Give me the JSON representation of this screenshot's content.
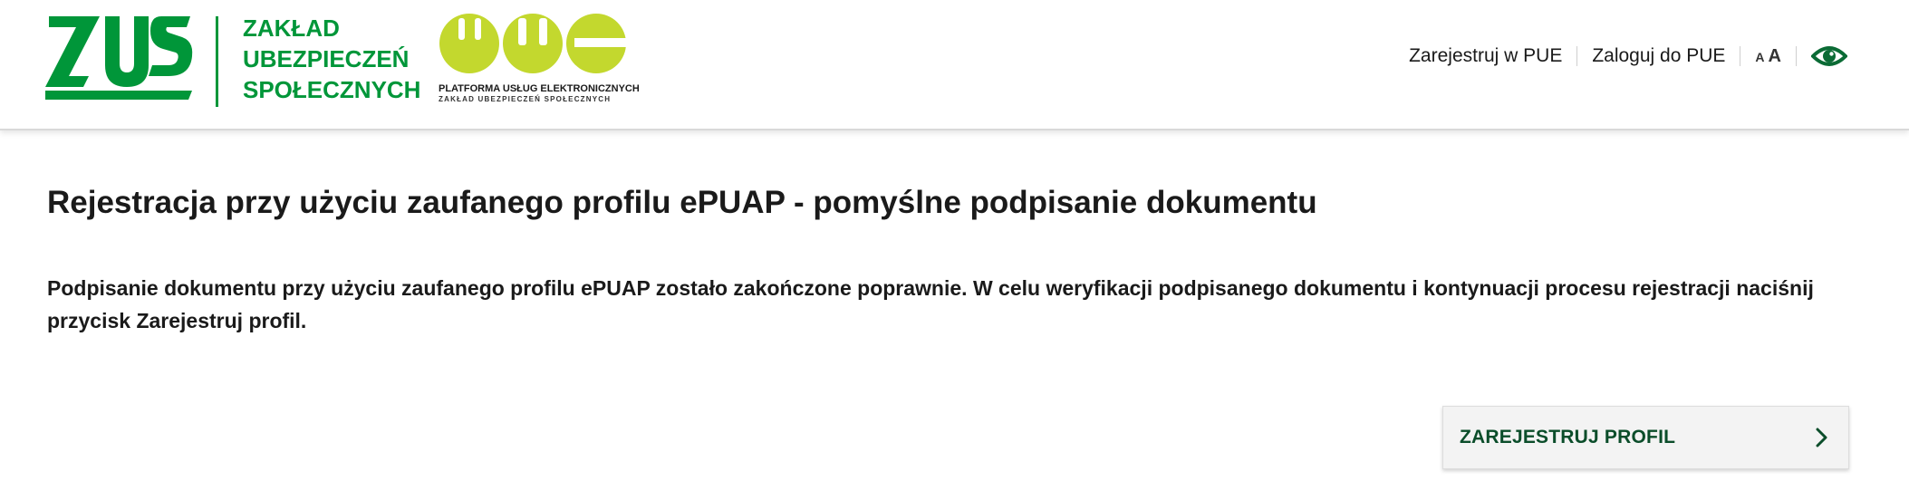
{
  "header": {
    "zus_logo_text": "ZUS",
    "institution_name": [
      "ZAKŁAD",
      "UBEZPIECZEŃ",
      "SPOŁECZNYCH"
    ],
    "pue_logo_text": "PUE",
    "pue_caption": "PLATFORMA USŁUG ELEKTRONICZNYCH",
    "pue_subcaption": "ZAKŁAD UBEZPIECZEŃ SPOŁECZNYCH",
    "nav": {
      "register_label": "Zarejestruj w PUE",
      "login_label": "Zaloguj do PUE",
      "font_small_label": "A",
      "font_large_label": "A"
    },
    "icons": {
      "contrast": "eye-icon",
      "button_arrow": "chevron-right-icon"
    }
  },
  "main": {
    "title": "Rejestracja przy użyciu zaufanego profilu ePUAP - pomyślne podpisanie dokumentu",
    "message": "Podpisanie dokumentu przy użyciu zaufanego profilu ePUAP zostało zakończone poprawnie. W celu weryfikacji podpisanego dokumentu i kontynuacji procesu rejestracji naciśnij przycisk Zarejestruj profil.",
    "register_button_label": "ZAREJESTRUJ PROFIL"
  },
  "colors": {
    "zus_green": "#009639",
    "pue_lime": "#C3D82E",
    "button_text": "#0B4D2A",
    "eye_icon": "#0B6B35"
  }
}
